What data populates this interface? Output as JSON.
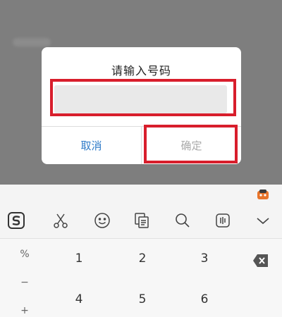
{
  "dialog": {
    "title": "请输入号码",
    "input_value": "",
    "cancel_label": "取消",
    "confirm_label": "确定"
  },
  "keyboard": {
    "symbol_keys": [
      "%",
      "−",
      "+"
    ],
    "digit_row_1": [
      "1",
      "2",
      "3"
    ],
    "digit_row_2": [
      "4",
      "5",
      "6"
    ],
    "toolbar_icons": [
      "sogou-logo-icon",
      "scissors-icon",
      "emoji-icon",
      "clipboard-icon",
      "search-icon",
      "voice-input-icon",
      "collapse-keyboard-icon"
    ],
    "extra_icons": [
      "skin-icon",
      "backspace-icon"
    ]
  },
  "colors": {
    "highlight": "#d81e2c",
    "cancel_text": "#2f7bc8",
    "confirm_text": "#aaaaaa",
    "overlay": "#7e7e7e"
  }
}
